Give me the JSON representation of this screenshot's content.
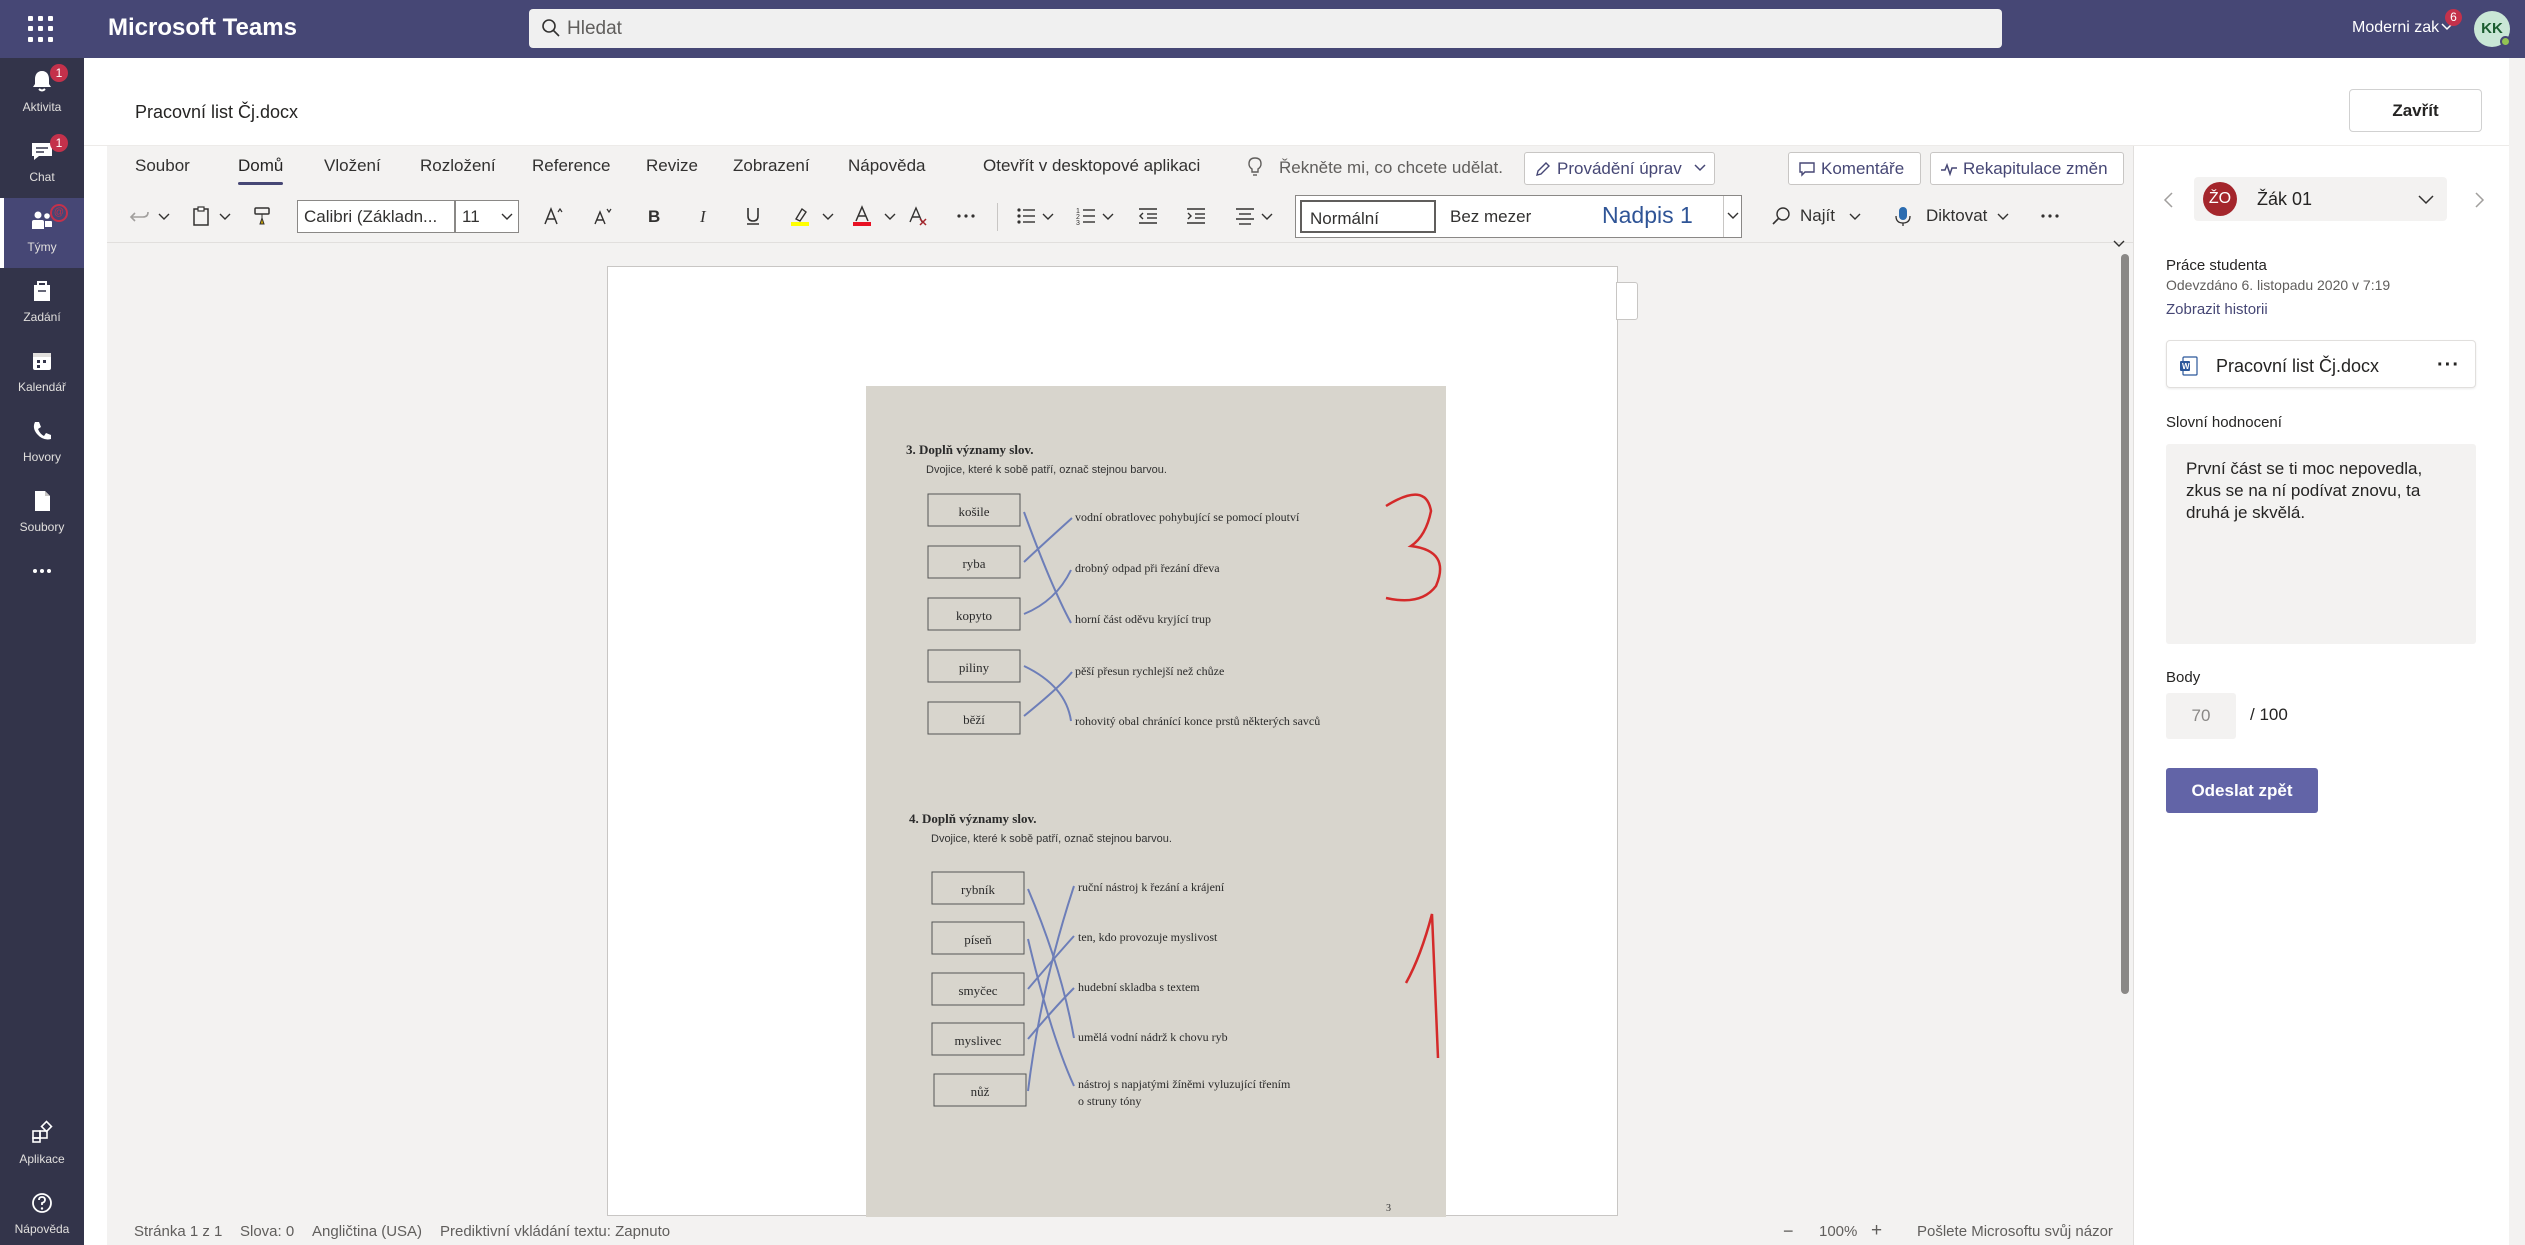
{
  "app": {
    "title": "Microsoft Teams",
    "user_name": "Moderni zak",
    "user_badge": "6",
    "avatar_initials": "KK"
  },
  "search": {
    "placeholder": "Hledat"
  },
  "rail": {
    "items": [
      {
        "label": "Aktivita",
        "badge": "1",
        "icon": "bell-icon"
      },
      {
        "label": "Chat",
        "badge": "1",
        "icon": "chat-icon"
      },
      {
        "label": "Týmy",
        "badge": "@",
        "icon": "teams-icon"
      },
      {
        "label": "Zadání",
        "icon": "assignments-icon"
      },
      {
        "label": "Kalendář",
        "icon": "calendar-icon"
      },
      {
        "label": "Hovory",
        "icon": "phone-icon"
      },
      {
        "label": "Soubory",
        "icon": "files-icon"
      },
      {
        "label": "Aplikace",
        "icon": "apps-icon"
      },
      {
        "label": "Nápověda",
        "icon": "help-icon"
      }
    ],
    "more_icon": "ellipsis-icon"
  },
  "document": {
    "title": "Pracovní list Čj.docx",
    "close_label": "Zavřít"
  },
  "word": {
    "menu_tabs": [
      "Soubor",
      "Domů",
      "Vložení",
      "Rozložení",
      "Reference",
      "Revize",
      "Zobrazení",
      "Nápověda"
    ],
    "active_tab": "Domů",
    "open_desktop": "Otevřít v desktopové aplikaci",
    "tell_me": "Řekněte mi, co chcete udělat.",
    "editing_mode": "Provádění úprav",
    "comments": "Komentáře",
    "changes_summary": "Rekapitulace změn",
    "font_name": "Calibri (Základn...",
    "font_size": "11",
    "styles": [
      "Normální",
      "Bez mezer",
      "Nadpis 1"
    ],
    "find": "Najít",
    "dictate": "Diktovat",
    "accent_highlight": "#ffff00",
    "accent_font_color": "#e81123"
  },
  "status": {
    "page": "Stránka 1 z 1",
    "words": "Slova: 0",
    "language": "Angličtina (USA)",
    "predictive": "Prediktivní vkládání textu: Zapnuto",
    "zoom": "100%",
    "feedback": "Pošlete Microsoftu svůj názor"
  },
  "worksheet": {
    "ex3": {
      "title": "3.  Doplň významy slov.",
      "subtitle": "Dvojice, které k sobě patří, označ stejnou barvou.",
      "words": [
        "košile",
        "ryba",
        "kopyto",
        "piliny",
        "běží"
      ],
      "meanings": [
        "vodní obratlovec pohybující se pomocí ploutví",
        "drobný odpad při řezání dřeva",
        "horní část oděvu kryjící trup",
        "pěší přesun rychlejší než chůze",
        "rohovitý obal chránící konce prstů některých savců"
      ],
      "mark": "3"
    },
    "ex4": {
      "title": "4.  Doplň významy slov.",
      "subtitle": "Dvojice, které k sobě patří, označ stejnou barvou.",
      "words": [
        "rybník",
        "píseň",
        "smyčec",
        "myslivec",
        "nůž"
      ],
      "meanings": [
        "ruční nástroj k řezání a krájení",
        "ten, kdo provozuje myslivost",
        "hudební skladba s textem",
        "umělá vodní nádrž k chovu ryb",
        "nástroj s napjatými žíněmi vyluzující třením",
        "o struny tóny"
      ],
      "mark": "1"
    },
    "page_number": "3"
  },
  "panel": {
    "student_initials": "ŽO",
    "student_name": "Žák 01",
    "work_label": "Práce studenta",
    "submitted": "Odevzdáno 6. listopadu 2020 v 7:19",
    "history_link": "Zobrazit historii",
    "file_name": "Pracovní list Čj.docx",
    "feedback_label": "Slovní hodnocení",
    "feedback_text": "První část se ti moc nepovedla, zkus se na ní podívat znovu, ta druhá je skvělá.",
    "points_label": "Body",
    "points_value": "70",
    "points_max": "/ 100",
    "send_back": "Odeslat zpět",
    "accent": "#6264a7"
  }
}
